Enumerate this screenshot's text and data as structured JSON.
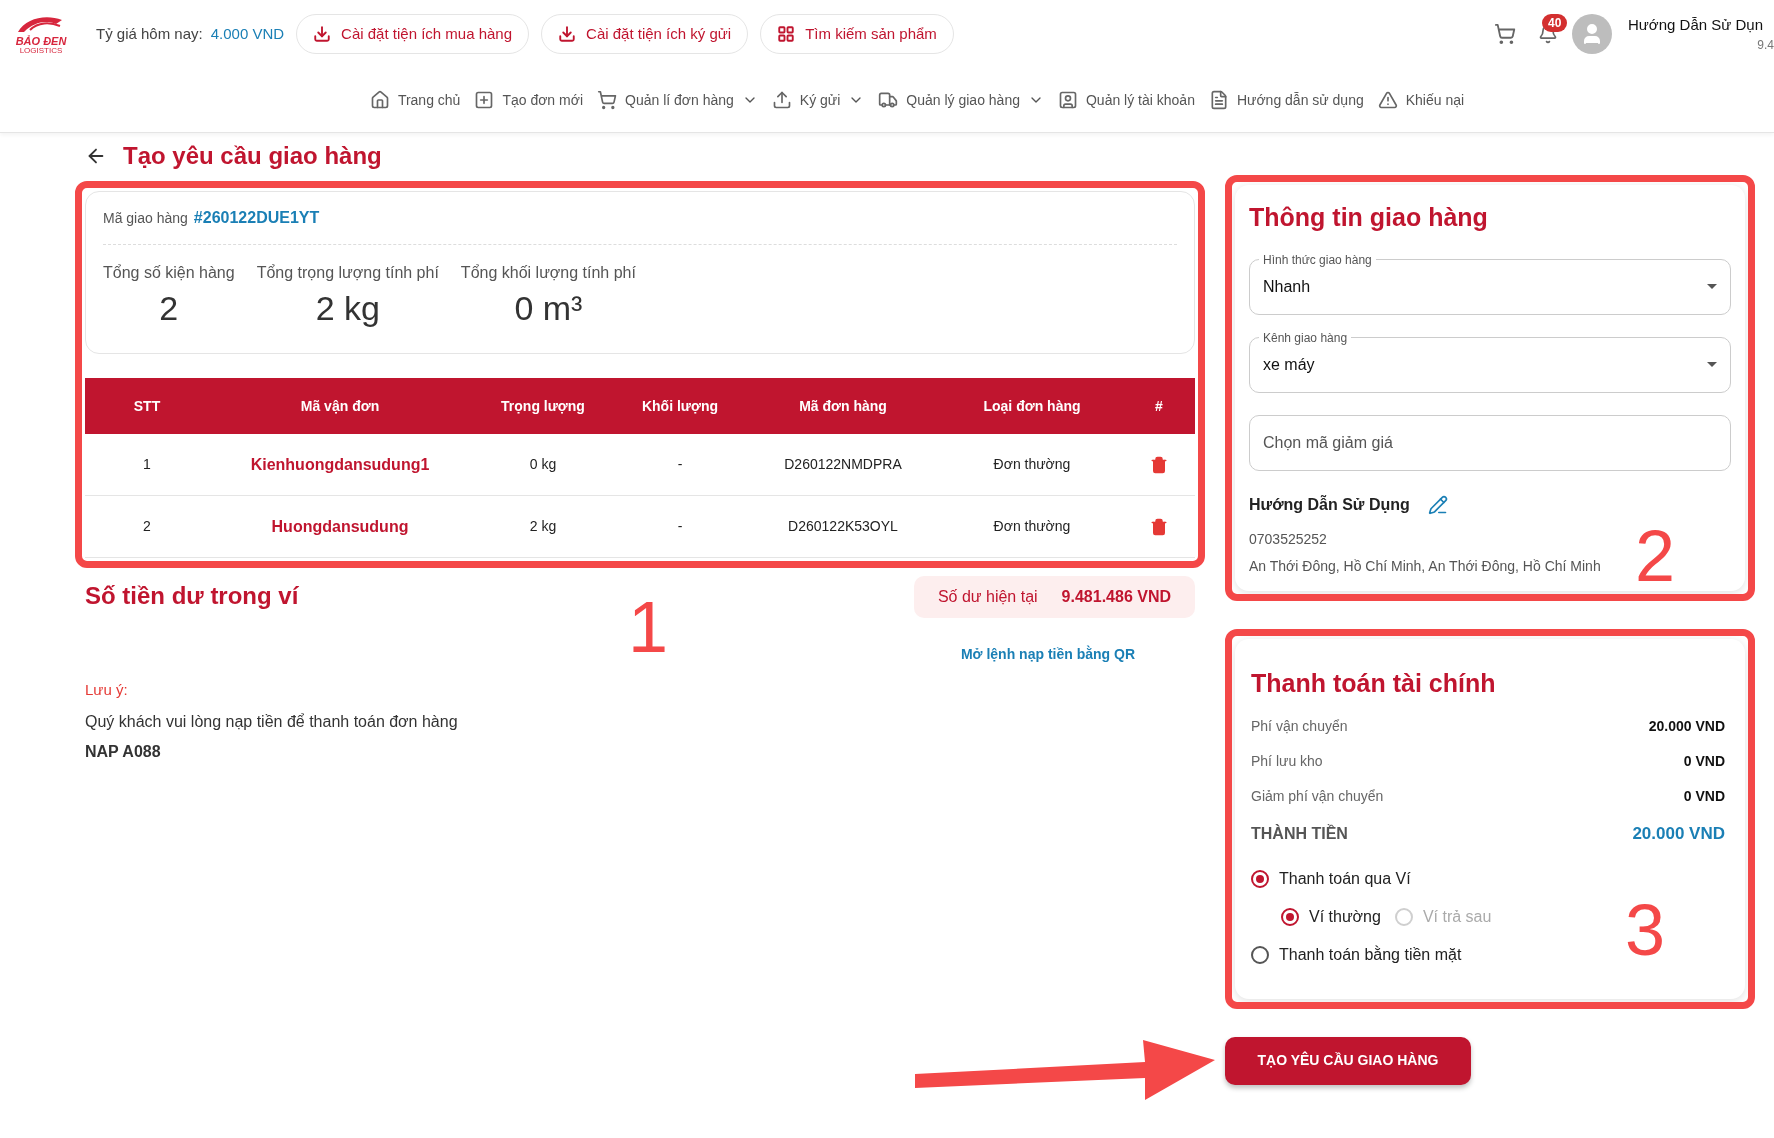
{
  "header": {
    "logo_text": "BẢO ĐEN",
    "logo_sub": "LOGISTICS",
    "rate_label": "Tỷ giá hôm nay:",
    "rate_value": "4.000 VND",
    "quick_buttons": [
      {
        "label": "Cài đặt tiện ích mua hàng",
        "kind": "download"
      },
      {
        "label": "Cài đặt tiện ích ký gửi",
        "kind": "download"
      },
      {
        "label": "Tìm kiếm sản phẩm",
        "kind": "grid"
      }
    ],
    "notification_count": "40",
    "user_name": "Hướng Dẫn Sử Dụn",
    "user_balance": "9.4"
  },
  "nav": [
    {
      "label": "Trang chủ",
      "kind": "home",
      "dropdown": false
    },
    {
      "label": "Tạo đơn mới",
      "kind": "plus",
      "dropdown": false
    },
    {
      "label": "Quản lí đơn hàng",
      "kind": "cart",
      "dropdown": true
    },
    {
      "label": "Ký gửi",
      "kind": "upload",
      "dropdown": true
    },
    {
      "label": "Quản lý giao hàng",
      "kind": "truck",
      "dropdown": true
    },
    {
      "label": "Quản lý tài khoản",
      "kind": "account",
      "dropdown": false
    },
    {
      "label": "Hướng dẫn sử dụng",
      "kind": "doc",
      "dropdown": false
    },
    {
      "label": "Khiếu nại",
      "kind": "warning",
      "dropdown": false
    }
  ],
  "page_title": "Tạo yêu cầu giao hàng",
  "shipment": {
    "annotation": "1",
    "code_label": "Mã giao hàng",
    "code": "#260122DUE1YT",
    "stats": [
      {
        "label": "Tổng số kiện hàng",
        "value": "2"
      },
      {
        "label": "Tổng trọng lượng tính phí",
        "value": "2 kg"
      },
      {
        "label": "Tổng khối lượng tính phí",
        "value": "0 m³"
      }
    ],
    "table": {
      "columns": [
        "STT",
        "Mã vận đơn",
        "Trọng lượng",
        "Khối lượng",
        "Mã đơn hàng",
        "Loại đơn hàng",
        "#"
      ],
      "rows": [
        [
          "1",
          "Kienhuongdansudung1",
          "0 kg",
          "-",
          "D260122NMDPRA",
          "Đơn thường"
        ],
        [
          "2",
          "Huongdansudung",
          "2 kg",
          "-",
          "D260122K53OYL",
          "Đơn thường"
        ]
      ]
    }
  },
  "wallet": {
    "title": "Số tiền dư trong ví",
    "balance_label": "Số dư hiện tại",
    "balance_value": "9.481.486 VND",
    "qr_link": "Mở lệnh nạp tiền bằng QR",
    "note_label": "Lưu ý:",
    "note_text": "Quý khách vui lòng nạp tiền để thanh toán đơn hàng",
    "note_code": "NAP A088"
  },
  "delivery": {
    "annotation": "2",
    "title": "Thông tin giao hàng",
    "selects": [
      {
        "label": "Hình thức giao hàng",
        "value": "Nhanh"
      },
      {
        "label": "Kênh giao hàng",
        "value": "xe máy"
      }
    ],
    "voucher": {
      "placeholder": "Chọn mã giảm giá"
    },
    "recipient": {
      "name": "Hướng Dẫn Sử Dụng",
      "phone": "0703525252",
      "address": "An Thới Đông, Hồ Chí Minh, An Thới Đông, Hồ Chí Minh"
    }
  },
  "payment": {
    "annotation": "3",
    "title": "Thanh toán tài chính",
    "fees": [
      {
        "label": "Phí vận chuyển",
        "value": "20.000 VND",
        "kind": "fee"
      },
      {
        "label": "Phí lưu kho",
        "value": "0 VND",
        "kind": "fee"
      },
      {
        "label": "Giảm phí vận chuyển",
        "value": "0 VND",
        "kind": "fee"
      },
      {
        "label": "THÀNH TIỀN",
        "value": "20.000 VND",
        "kind": "total"
      }
    ],
    "options": [
      {
        "label": "Thanh toán qua Ví",
        "selected": true,
        "sub_options": [
          {
            "label": "Ví thường",
            "selected": true,
            "disabled": false
          },
          {
            "label": "Ví trả sau",
            "selected": false,
            "disabled": true
          }
        ]
      },
      {
        "label": "Thanh toán bằng tiền mặt",
        "selected": false
      }
    ]
  },
  "submit_button": "TẠO YÊU CẦU GIAO HÀNG",
  "annotation_arrow": true
}
